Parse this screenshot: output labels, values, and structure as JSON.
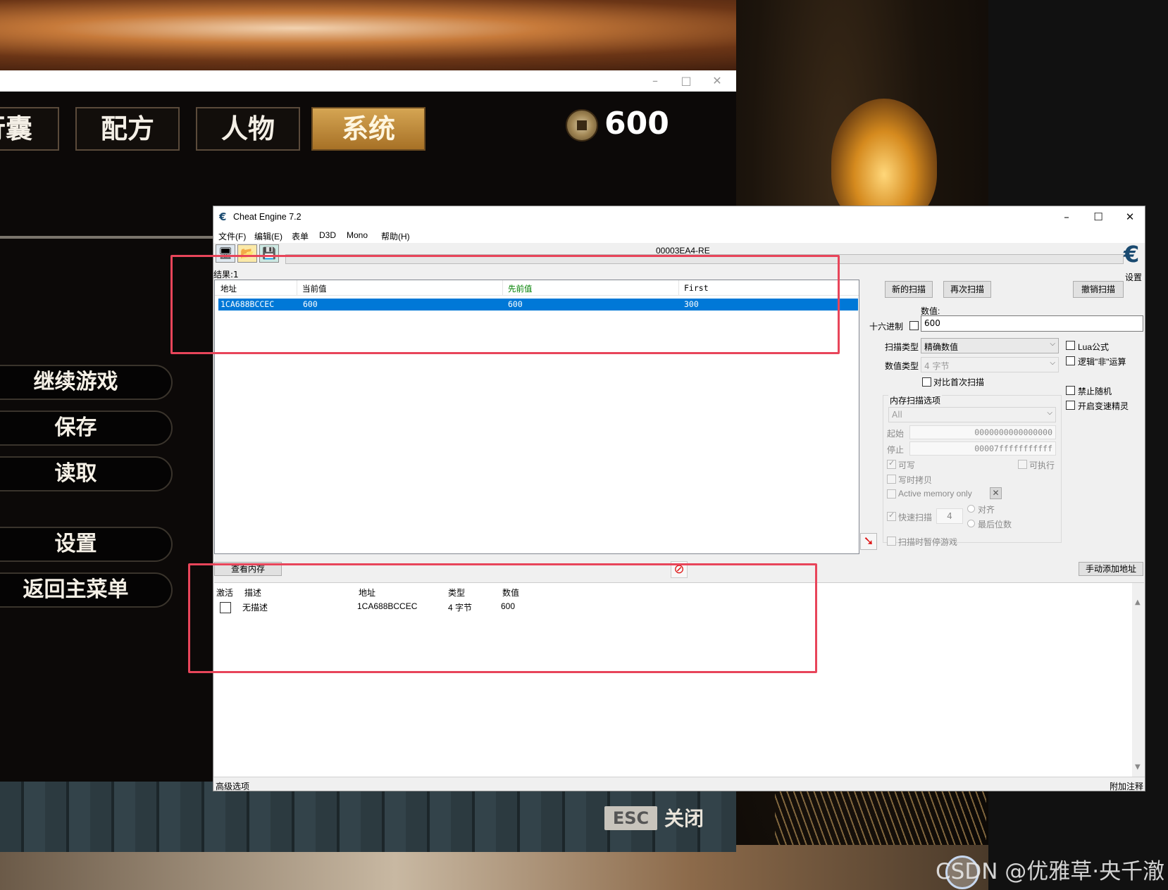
{
  "game": {
    "tabs": [
      "行囊",
      "配方",
      "人物",
      "系统"
    ],
    "active_tab": "系统",
    "coins": "600",
    "menu": [
      "继续游戏",
      "保存",
      "读取",
      "设置",
      "返回主菜单"
    ],
    "esc_key": "ESC",
    "esc_label": "关闭"
  },
  "ce": {
    "title": "Cheat Engine 7.2",
    "menu": [
      "文件(F)",
      "编辑(E)",
      "表单",
      "D3D",
      "Mono",
      "帮助(H)"
    ],
    "process": "00003EA4-RE",
    "settings_label": "设置",
    "results_label": "结果:1",
    "columns": [
      "地址",
      "当前值",
      "先前值",
      "First"
    ],
    "result_row": {
      "address": "1CA688BCCEC",
      "current": "600",
      "previous": "600",
      "first": "300"
    },
    "buttons": {
      "new_scan": "新的扫描",
      "next_scan": "再次扫描",
      "undo_scan": "撤销扫描",
      "view_memory": "查看内存",
      "add_manual": "手动添加地址"
    },
    "value_label": "数值:",
    "hex_label": "十六进制",
    "value_input": "600",
    "scan_type_label": "扫描类型",
    "scan_type": "精确数值",
    "value_type_label": "数值类型",
    "value_type": "4 字节",
    "compare_first": "对比首次扫描",
    "lua_formula": "Lua公式",
    "logic_not": "逻辑\"非\"运算",
    "no_random": "禁止随机",
    "speedhack": "开启变速精灵",
    "mem_options_label": "内存扫描选项",
    "mem_region": "All",
    "start_label": "起始",
    "start_value": "0000000000000000",
    "stop_label": "停止",
    "stop_value": "00007fffffffffff",
    "writable": "可写",
    "executable": "可执行",
    "copy_on_write": "写时拷贝",
    "active_memory_only": "Active memory only",
    "fast_scan": "快速扫描",
    "fast_scan_value": "4",
    "align": "对齐",
    "last_digits": "最后位数",
    "pause_game": "扫描时暂停游戏",
    "addr_columns": [
      "激活",
      "描述",
      "地址",
      "类型",
      "数值"
    ],
    "addr_row": {
      "description": "无描述",
      "address": "1CA688BCCEC",
      "type": "4 字节",
      "value": "600"
    },
    "advanced_options": "高级选项",
    "add_comment": "附加注释"
  },
  "watermark": "CSDN @优雅草·央千澈",
  "colors": {
    "highlight": "#e8455a",
    "selection": "#0078d7",
    "previous_header": "#008000"
  }
}
